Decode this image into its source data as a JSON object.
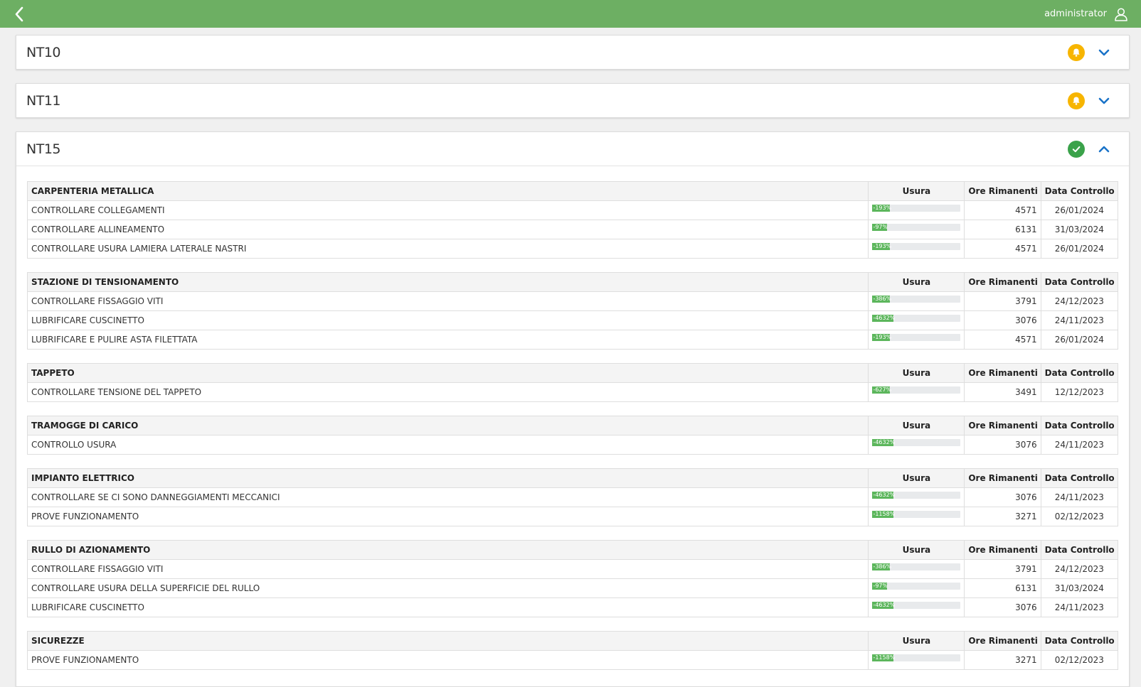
{
  "header": {
    "user": "administrator"
  },
  "panels": [
    {
      "title": "NT10",
      "status": "warning",
      "status_color": "#f7b500",
      "expanded": false
    },
    {
      "title": "NT11",
      "status": "warning",
      "status_color": "#f7b500",
      "expanded": false
    },
    {
      "title": "NT15",
      "status": "ok",
      "status_color": "#3aa24a",
      "expanded": true
    }
  ],
  "columns": {
    "usura": "Usura",
    "ore": "Ore Rimanenti",
    "data": "Data Controllo"
  },
  "groups": [
    {
      "name": "CARPENTERIA METALLICA",
      "rows": [
        {
          "task": "CONTROLLARE COLLEGAMENTI",
          "usura": "-193%",
          "ore": "4571",
          "data": "26/01/2024"
        },
        {
          "task": "CONTROLLARE ALLINEAMENTO",
          "usura": "-97%",
          "ore": "6131",
          "data": "31/03/2024"
        },
        {
          "task": "CONTROLLARE USURA LAMIERA LATERALE NASTRI",
          "usura": "-193%",
          "ore": "4571",
          "data": "26/01/2024"
        }
      ]
    },
    {
      "name": "STAZIONE DI TENSIONAMENTO",
      "rows": [
        {
          "task": "CONTROLLARE FISSAGGIO VITI",
          "usura": "-386%",
          "ore": "3791",
          "data": "24/12/2023"
        },
        {
          "task": "LUBRIFICARE CUSCINETTO",
          "usura": "-4632%",
          "ore": "3076",
          "data": "24/11/2023"
        },
        {
          "task": "LUBRIFICARE E PULIRE ASTA FILETTATA",
          "usura": "-193%",
          "ore": "4571",
          "data": "26/01/2024"
        }
      ]
    },
    {
      "name": "TAPPETO",
      "rows": [
        {
          "task": "CONTROLLARE TENSIONE DEL TAPPETO",
          "usura": "-627%",
          "ore": "3491",
          "data": "12/12/2023"
        }
      ]
    },
    {
      "name": "TRAMOGGE DI CARICO",
      "rows": [
        {
          "task": "CONTROLLO USURA",
          "usura": "-4632%",
          "ore": "3076",
          "data": "24/11/2023"
        }
      ]
    },
    {
      "name": "IMPIANTO ELETTRICO",
      "rows": [
        {
          "task": "CONTROLLARE SE CI SONO DANNEGGIAMENTI MECCANICI",
          "usura": "-4632%",
          "ore": "3076",
          "data": "24/11/2023"
        },
        {
          "task": "PROVE FUNZIONAMENTO",
          "usura": "-1158%",
          "ore": "3271",
          "data": "02/12/2023"
        }
      ]
    },
    {
      "name": "RULLO DI AZIONAMENTO",
      "rows": [
        {
          "task": "CONTROLLARE FISSAGGIO VITI",
          "usura": "-386%",
          "ore": "3791",
          "data": "24/12/2023"
        },
        {
          "task": "CONTROLLARE USURA DELLA SUPERFICIE DEL RULLO",
          "usura": "-97%",
          "ore": "6131",
          "data": "31/03/2024"
        },
        {
          "task": "LUBRIFICARE CUSCINETTO",
          "usura": "-4632%",
          "ore": "3076",
          "data": "24/11/2023"
        }
      ]
    },
    {
      "name": "SICUREZZE",
      "rows": [
        {
          "task": "PROVE FUNZIONAMENTO",
          "usura": "-1158%",
          "ore": "3271",
          "data": "02/12/2023"
        }
      ]
    }
  ],
  "icons": {
    "back": "chevron-left-icon",
    "user": "user-icon",
    "warning": "bell-icon",
    "ok": "check-icon",
    "collapse": "chevron-down-icon",
    "expand": "chevron-up-icon"
  },
  "colors": {
    "topbar": "#6daf63",
    "bar_fill": "#5cb65c",
    "chevron": "#1a73c8"
  }
}
